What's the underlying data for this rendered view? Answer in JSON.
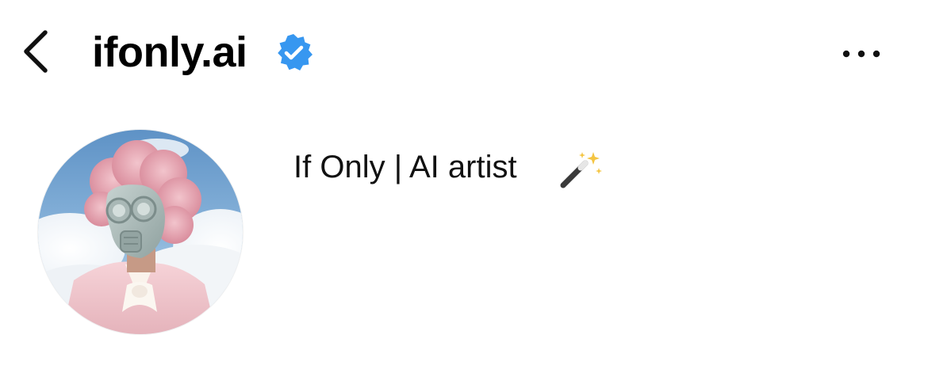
{
  "header": {
    "username": "ifonly.ai",
    "back_icon": "chevron-left-icon",
    "verified_icon": "verified-badge-icon",
    "more_icon": "more-horizontal-icon",
    "verified_color": "#3797F0"
  },
  "profile": {
    "display_name": "If Only | AI artist",
    "name_emoji": "magic-wand-icon",
    "avatar_icon": "avatar-image"
  },
  "colors": {
    "background": "#FFFFFF",
    "text": "#000000",
    "sky": "#6F9FCB",
    "hair": "#E8A7B4",
    "suit": "#F0C6CC"
  }
}
